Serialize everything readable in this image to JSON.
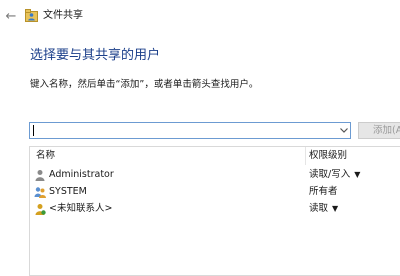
{
  "window": {
    "title": "文件共享",
    "back_icon": "back-arrow-icon",
    "app_icon": "file-share-icon"
  },
  "heading": "选择要与其共享的用户",
  "instruction": "键入名称，然后单击“添加”，或者单击箭头查找用户。",
  "input": {
    "value": "",
    "placeholder": ""
  },
  "add_button": {
    "label": "添加(A"
  },
  "table": {
    "columns": [
      "名称",
      "权限级别"
    ],
    "rows": [
      {
        "name": "Administrator",
        "permission": "读取/写入",
        "has_dropdown": true,
        "icon": "user-icon"
      },
      {
        "name": "SYSTEM",
        "permission": "所有者",
        "has_dropdown": false,
        "icon": "group-icon"
      },
      {
        "name": "<未知联系人>",
        "permission": "读取",
        "has_dropdown": true,
        "icon": "unknown-contact-icon"
      }
    ]
  },
  "colors": {
    "heading": "#1b3f8a",
    "input_border": "#6c9bd2",
    "disabled_text": "#9a9a9a"
  }
}
